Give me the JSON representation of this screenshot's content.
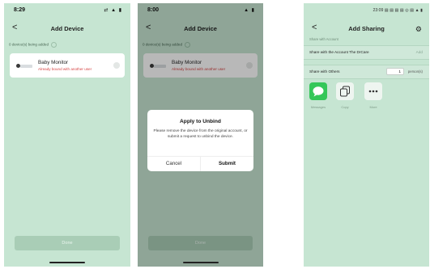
{
  "screen1": {
    "time": "8:29",
    "status_icons": "⇄ ▲ ▮",
    "title": "Add Device",
    "back": "<",
    "note": "0 device(s) being added",
    "device_name": "Baby Monitor",
    "device_sub": "Already bound with another user",
    "done": "Done"
  },
  "screen2": {
    "time": "8:00",
    "status_icons": "▲ ▮",
    "title": "Add Device",
    "back": "<",
    "note": "0 device(s) being added",
    "device_name": "Baby Monitor",
    "device_sub": "Already bound with another user",
    "done": "Done",
    "dialog_title": "Apply to Unbind",
    "dialog_message": "Please remove the device from the original account, or submit a request to unbind the device.",
    "cancel": "Cancel",
    "submit": "Submit"
  },
  "screen3": {
    "status": "23:09 ▤ ▤ ▤ ▤ ◎ ▤ ▲ ▮",
    "title": "Add Sharing",
    "back": "<",
    "section1": "Share with Account",
    "row1_label": "Share with the Account The DrCare",
    "row1_action": "Add",
    "section2": "Share with Others",
    "count": "1",
    "count_unit": "person(s)",
    "share_options": [
      "Messages",
      "Copy",
      "More"
    ]
  },
  "colors": {
    "background": "#c6e5d2",
    "accent_red": "#d64545",
    "messages_green": "#34c759"
  }
}
